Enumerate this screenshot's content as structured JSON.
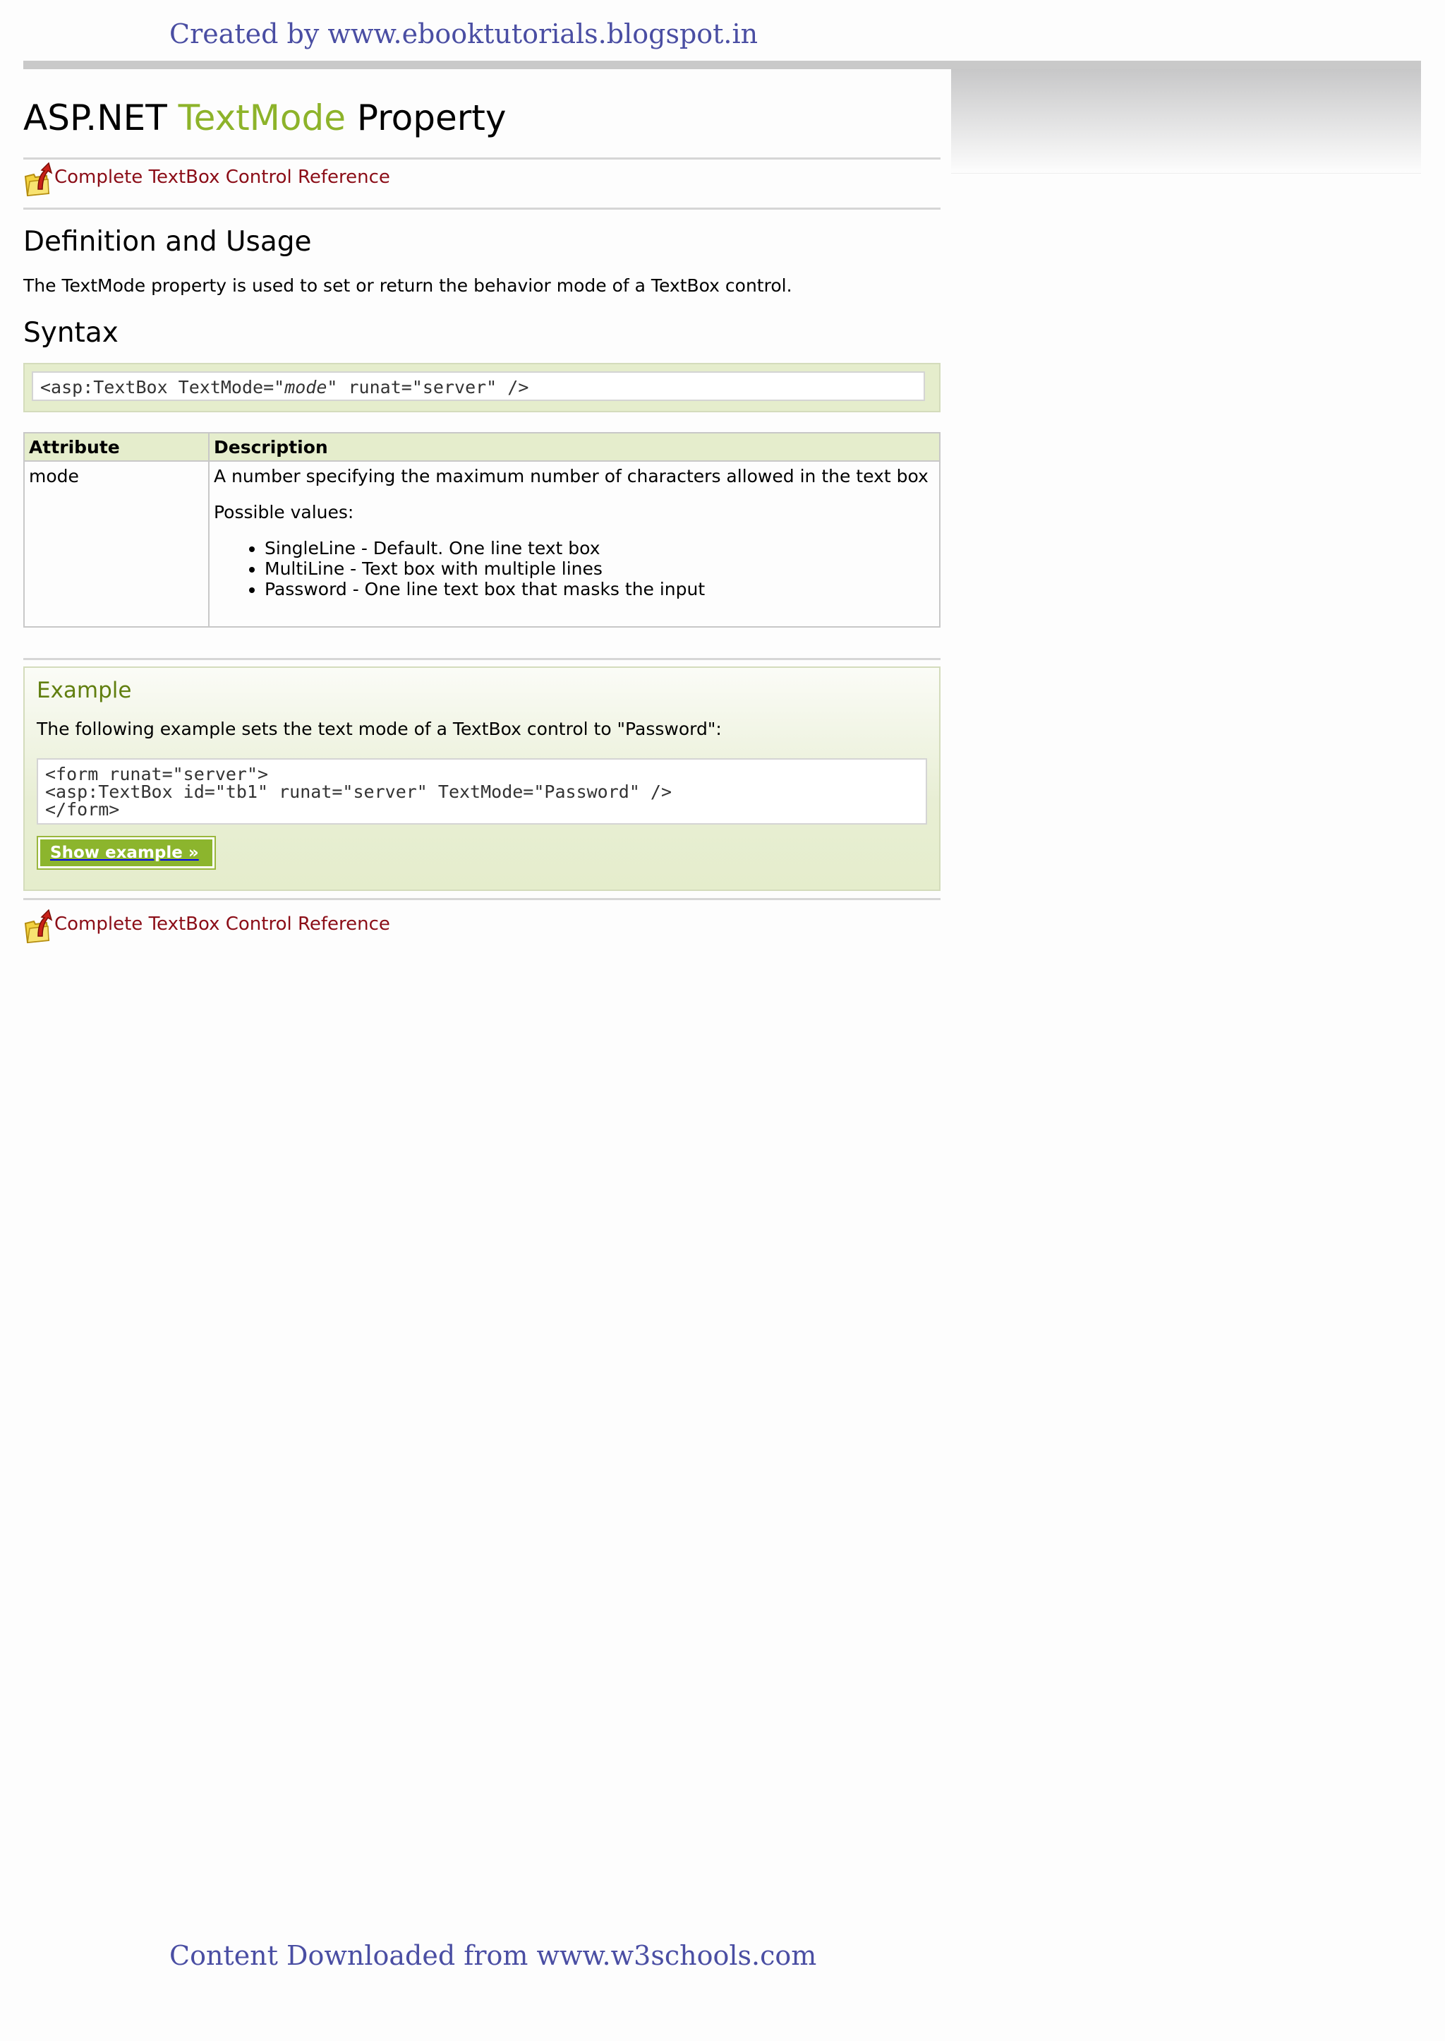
{
  "watermark": {
    "top": "Created by www.ebooktutorials.blogspot.in",
    "bottom": "Content Downloaded from www.w3schools.com"
  },
  "page": {
    "title_prefix": "ASP.NET ",
    "title_highlight": "TextMode",
    "title_suffix": " Property",
    "back_link": " Complete TextBox Control Reference"
  },
  "definition": {
    "heading": "Definition and Usage",
    "text": "The TextMode property is used to set or return the behavior mode of a TextBox control."
  },
  "syntax": {
    "heading": "Syntax",
    "code_before": "<asp:TextBox TextMode=\"",
    "code_param": "mode",
    "code_after": "\" runat=\"server\" />"
  },
  "attributes_table": {
    "headers": [
      "Attribute",
      "Description"
    ],
    "rows": [
      {
        "attribute": "mode",
        "description": "A number specifying the maximum number of characters allowed in the text box",
        "possible_label": "Possible values:",
        "values": [
          "SingleLine - Default. One line text box",
          "MultiLine - Text box with multiple lines",
          "Password - One line text box that masks the input"
        ]
      }
    ]
  },
  "example": {
    "heading": "Example",
    "description": "The following example sets the text mode of a TextBox control to \"Password\":",
    "code": "<form runat=\"server\">\n<asp:TextBox id=\"tb1\" runat=\"server\" TextMode=\"Password\" />\n</form>",
    "button_label": "Show example »"
  },
  "icons": {
    "back_link_icon": "folder-up-arrow-icon"
  },
  "colors": {
    "highlight": "#8db32a",
    "link": "#8b0d17",
    "example_heading": "#617f10",
    "button": "#8cb52d"
  }
}
